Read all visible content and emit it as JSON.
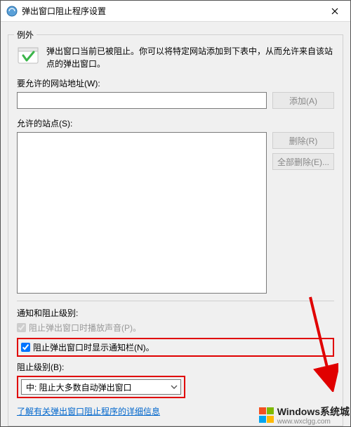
{
  "window": {
    "title": "弹出窗口阻止程序设置"
  },
  "group": {
    "legend": "例外",
    "info": "弹出窗口当前已被阻止。你可以将特定网站添加到下表中，从而允许来自该站点的弹出窗口。",
    "address_label": "要允许的网站地址(W):",
    "add_button": "添加(A)",
    "allowed_label": "允许的站点(S):",
    "remove_button": "删除(R)",
    "remove_all_button": "全部删除(E)..."
  },
  "settings": {
    "section_label": "通知和阻止级别:",
    "play_sound": "阻止弹出窗口时播放声音(P)。",
    "show_notification": "阻止弹出窗口时显示通知栏(N)。",
    "level_label": "阻止级别(B):",
    "level_value": "中: 阻止大多数自动弹出窗口"
  },
  "footer": {
    "learn_more": "了解有关弹出窗口阻止程序的详细信息"
  },
  "watermark": {
    "brand": "Windows系统城",
    "url": "www.wxclgg.com"
  }
}
